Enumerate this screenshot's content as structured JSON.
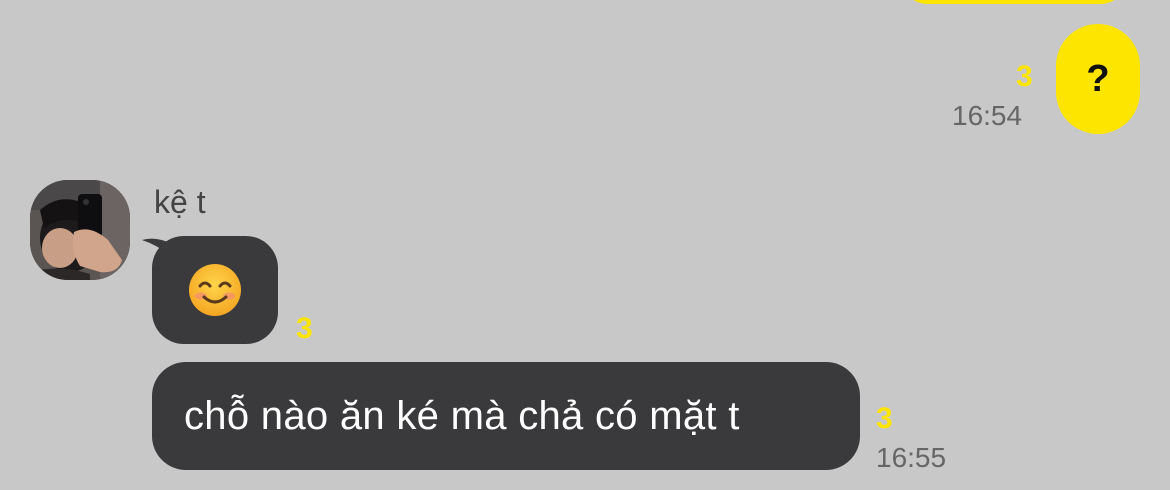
{
  "outgoing": {
    "message_text": "?",
    "unread_count": "3",
    "timestamp": "16:54"
  },
  "incoming": {
    "sender_name": "kệ t",
    "avatar_icon": "profile-photo-mirror-selfie",
    "emoji_icon": "smiling-face-emoji",
    "emoji_unread": "3",
    "message_text": "chỗ nào ăn ké mà chả có mặt t",
    "message_unread": "3",
    "timestamp": "16:55"
  },
  "colors": {
    "background": "#c8c8c8",
    "outgoing_bubble": "#fee500",
    "incoming_bubble": "#3a3a3c",
    "unread": "#fee500",
    "timestamp": "#666666"
  }
}
